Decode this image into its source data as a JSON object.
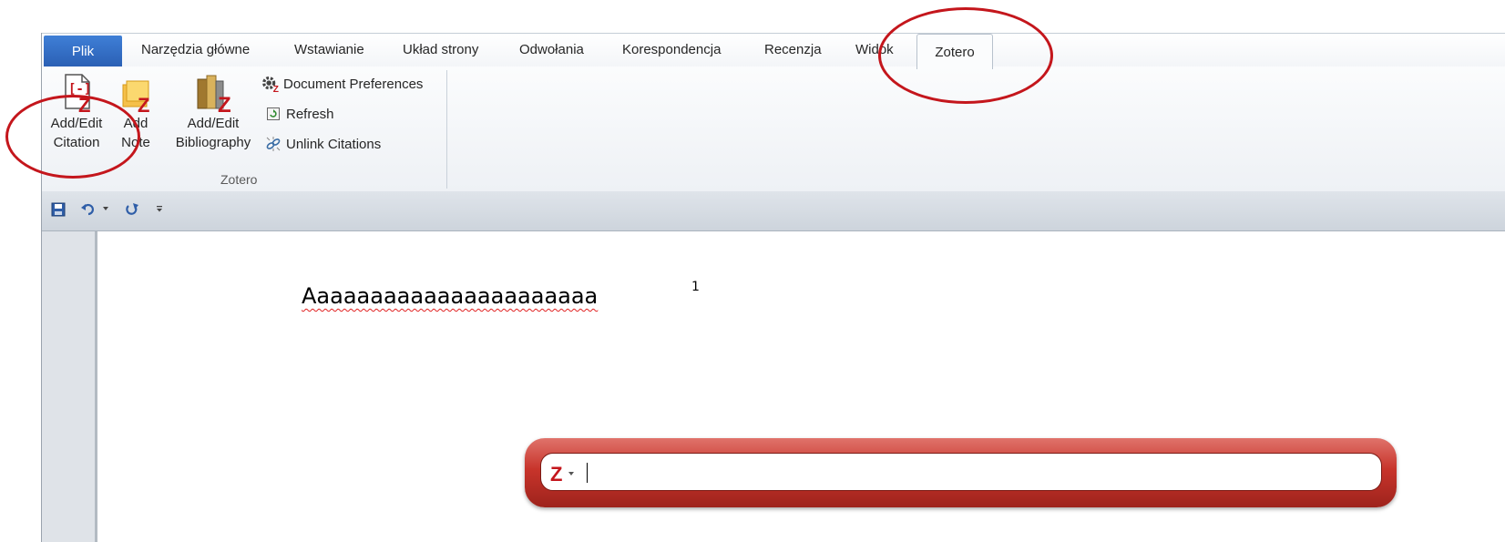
{
  "tabs": {
    "file": "Plik",
    "items": [
      "Narzędzia główne",
      "Wstawianie",
      "Układ strony",
      "Odwołania",
      "Korespondencja",
      "Recenzja",
      "Widok"
    ],
    "active": "Zotero"
  },
  "ribbon": {
    "group_label": "Zotero",
    "add_edit_citation": [
      "Add/Edit",
      "Citation"
    ],
    "add_note": [
      "Add",
      "Note"
    ],
    "add_edit_bibliography": [
      "Add/Edit",
      "Bibliography"
    ],
    "document_preferences": "Document Preferences",
    "refresh": "Refresh",
    "unlink_citations": "Unlink Citations"
  },
  "document": {
    "text": "Aaaaaaaaaaaaaaaaaaaaaa",
    "footnote_ref": "1"
  },
  "quick_format": {
    "value": ""
  },
  "colors": {
    "file_tab": "#2a5fb4",
    "zotero_red": "#c7342b",
    "annotation": "#c4161c"
  }
}
